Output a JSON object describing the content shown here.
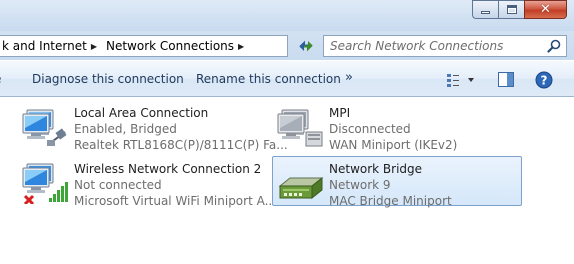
{
  "breadcrumb": {
    "parent": "k and Internet",
    "current": "Network Connections"
  },
  "search": {
    "placeholder": "Search Network Connections"
  },
  "toolbar": {
    "diagnose": "Diagnose this connection",
    "rename": "Rename this connection",
    "more": "»"
  },
  "connections": [
    {
      "name": "Local Area Connection",
      "status": "Enabled, Bridged",
      "device": "Realtek RTL8168C(P)/8111C(P) Fa...",
      "icon": "wired-network-icon"
    },
    {
      "name": "MPI",
      "status": "Disconnected",
      "device": "WAN Miniport (IKEv2)",
      "icon": "wan-network-icon"
    },
    {
      "name": "Wireless Network Connection 2",
      "status": "Not connected",
      "device": "Microsoft Virtual WiFi Miniport A...",
      "icon": "wireless-network-icon"
    },
    {
      "name": "Network Bridge",
      "status": "Network  9",
      "device": "MAC Bridge Miniport",
      "icon": "network-bridge-icon",
      "selected": true
    }
  ],
  "colors": {
    "accent": "#1e395b",
    "selection": "#d5e7fa",
    "close": "#c13e25"
  }
}
